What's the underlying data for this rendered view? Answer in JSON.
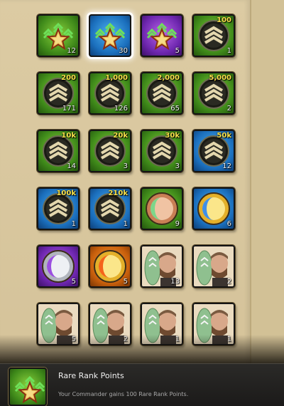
{
  "tiles": [
    {
      "color": "green",
      "icon": "arrows-star-icon",
      "count": "12",
      "cost": ""
    },
    {
      "color": "blue",
      "icon": "arrows-star-icon",
      "count": "30",
      "cost": ""
    },
    {
      "color": "purple",
      "icon": "arrows-star-icon",
      "count": "5",
      "cost": ""
    },
    {
      "color": "green",
      "icon": "chevron-medal-icon",
      "count": "1",
      "cost": "100"
    },
    {
      "color": "green",
      "icon": "chevron-medal-icon",
      "count": "171",
      "cost": "200"
    },
    {
      "color": "green",
      "icon": "chevron-medal-icon",
      "count": "126",
      "cost": "1,000"
    },
    {
      "color": "green",
      "icon": "chevron-medal-icon",
      "count": "65",
      "cost": "2,000"
    },
    {
      "color": "green",
      "icon": "chevron-medal-icon",
      "count": "2",
      "cost": "5,000"
    },
    {
      "color": "green",
      "icon": "chevron-medal-icon",
      "count": "14",
      "cost": "10k"
    },
    {
      "color": "green",
      "icon": "chevron-medal-icon",
      "count": "3",
      "cost": "20k"
    },
    {
      "color": "green",
      "icon": "chevron-medal-icon",
      "count": "3",
      "cost": "30k"
    },
    {
      "color": "blue",
      "icon": "chevron-medal-icon",
      "count": "12",
      "cost": "50k"
    },
    {
      "color": "blue",
      "icon": "chevron-medal-icon",
      "count": "1",
      "cost": "100k"
    },
    {
      "color": "blue",
      "icon": "chevron-medal-icon",
      "count": "1",
      "cost": "210k"
    },
    {
      "color": "green",
      "icon": "bronze-disc-icon",
      "count": "9",
      "cost": ""
    },
    {
      "color": "blue",
      "icon": "gold-disc-icon",
      "count": "6",
      "cost": ""
    },
    {
      "color": "purple",
      "icon": "silver-disc-icon",
      "count": "5",
      "cost": ""
    },
    {
      "color": "orange",
      "icon": "gold-disc-icon",
      "count": "5",
      "cost": ""
    },
    {
      "color": "portrait",
      "icon": "commander-portrait-icon",
      "count": "13",
      "cost": ""
    },
    {
      "color": "portrait",
      "icon": "commander-portrait-icon",
      "count": "2",
      "cost": ""
    },
    {
      "color": "portrait",
      "icon": "commander-portrait-icon",
      "count": "5",
      "cost": ""
    },
    {
      "color": "portrait",
      "icon": "commander-portrait-icon",
      "count": "2",
      "cost": ""
    },
    {
      "color": "portrait",
      "icon": "commander-portrait-icon",
      "count": "1",
      "cost": ""
    },
    {
      "color": "portrait",
      "icon": "commander-portrait-icon",
      "count": "1",
      "cost": ""
    }
  ],
  "selected_index": 1,
  "tooltip": {
    "icon": "arrows-star-icon",
    "color": "blue",
    "title": "Rare Rank Points",
    "description": "Your Commander gains 100 Rare Rank Points."
  },
  "colors": {
    "green": "#3f8a1a",
    "blue": "#1b6fbd",
    "purple": "#6d26ae",
    "orange": "#c85f0c",
    "cost_text": "#f6e04a",
    "count_text": "#f2f2f2"
  }
}
